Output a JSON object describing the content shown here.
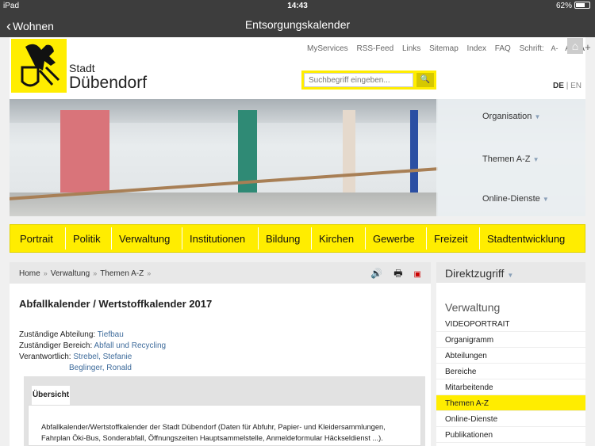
{
  "status": {
    "device": "iPad",
    "time": "14:43",
    "battery": "62%"
  },
  "nav": {
    "back_label": "Wohnen",
    "title": "Entsorgungskalender"
  },
  "header": {
    "city_line1": "Stadt",
    "city_line2": "Dübendorf",
    "links": [
      "MyServices",
      "RSS-Feed",
      "Links",
      "Sitemap",
      "Index",
      "FAQ"
    ],
    "font_label": "Schrift:",
    "font_small": "A-",
    "font_normal": "A",
    "font_large": "A+",
    "search_placeholder": "Suchbegriff eingeben...",
    "lang_de": "DE",
    "lang_en": "EN"
  },
  "hero": {
    "items": [
      "Organisation",
      "Themen A-Z",
      "Online-Dienste"
    ]
  },
  "menu": [
    "Portrait",
    "Politik",
    "Verwaltung",
    "Institutionen",
    "Bildung",
    "Kirchen",
    "Gewerbe",
    "Freizeit",
    "Stadtentwicklung"
  ],
  "breadcrumb": [
    "Home",
    "Verwaltung",
    "Themen A-Z"
  ],
  "page": {
    "title": "Abfallkalender / Wertstoffkalender 2017",
    "dept_label": "Zuständige Abteilung:",
    "dept_value": "Tiefbau",
    "area_label": "Zuständiger Bereich:",
    "area_value": "Abfall und Recycling",
    "resp_label": "Verantwortlich:",
    "resp_1": "Strebel, Stefanie",
    "resp_2": "Beglinger, Ronald",
    "tab_label": "Übersicht",
    "body": "Abfallkalender/Wertstoffkalender der Stadt Dübendorf (Daten für Abfuhr, Papier- und Kleidersammlungen, Fahrplan Öki-Bus, Sonderabfall, Öffnungszeiten Hauptsammelstelle, Anmeldeformular Häckseldienst ...)."
  },
  "sidebar": {
    "title": "Direktzugriff",
    "section": "Verwaltung",
    "items": [
      "VIDEOPORTRAIT",
      "Organigramm",
      "Abteilungen",
      "Bereiche",
      "Mitarbeitende",
      "Themen A-Z",
      "Online-Dienste",
      "Publikationen"
    ],
    "active": "Themen A-Z"
  },
  "colors": {
    "accent": "#ffed00",
    "link": "#3e6b9b",
    "chrome": "#3d3d3d"
  }
}
